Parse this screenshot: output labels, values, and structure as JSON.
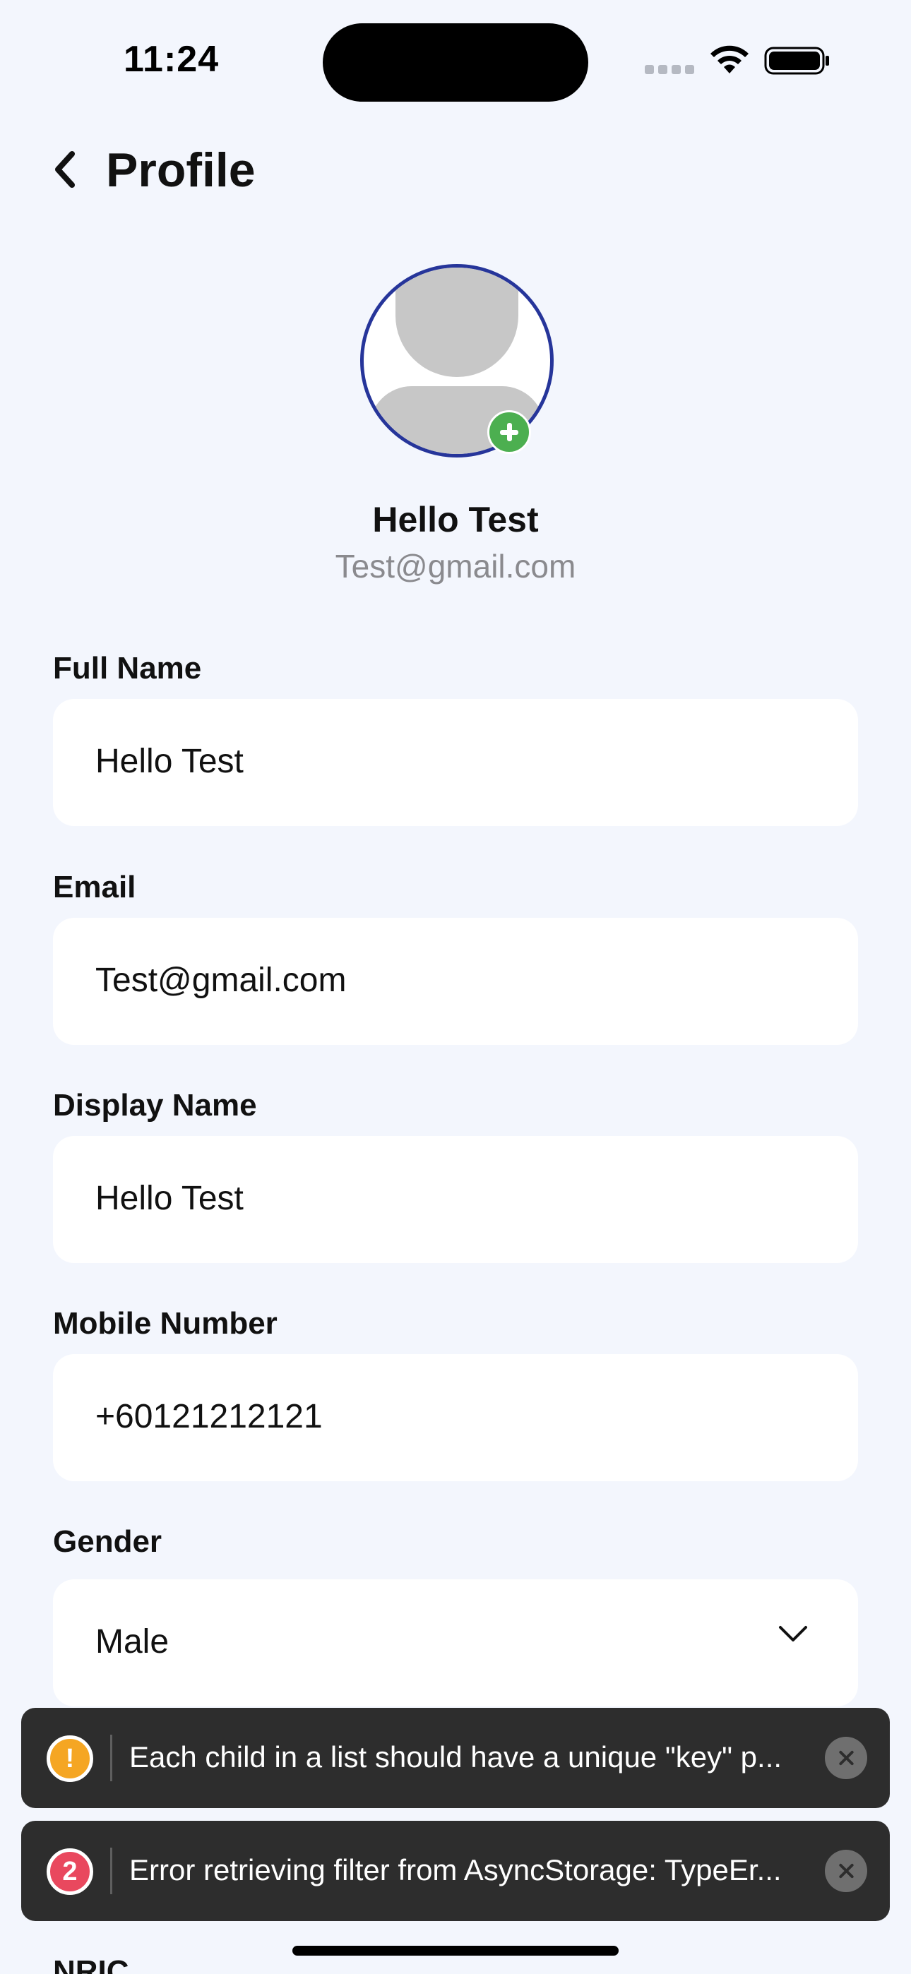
{
  "status_bar": {
    "time": "11:24",
    "icons": [
      "signal-dots-icon",
      "wifi-icon",
      "battery-icon"
    ]
  },
  "header": {
    "back_icon": "chevron-left-icon",
    "title": "Profile"
  },
  "profile": {
    "name": "Hello Test",
    "email": "Test@gmail.com"
  },
  "form": {
    "full_name": {
      "label": "Full Name",
      "value": "Hello Test"
    },
    "email": {
      "label": "Email",
      "value": "Test@gmail.com"
    },
    "display_name": {
      "label": "Display Name",
      "value": "Hello Test"
    },
    "mobile_number": {
      "label": "Mobile Number",
      "value": "+60121212121"
    },
    "gender": {
      "label": "Gender",
      "value": "Male"
    },
    "nric": {
      "label": "NRIC"
    }
  },
  "toasts": [
    {
      "type": "warning",
      "badge": "!",
      "message": "Each child in a list should have a unique \"key\" p...",
      "color": "#f5a623"
    },
    {
      "type": "error",
      "badge": "2",
      "message": "Error retrieving filter from AsyncStorage: TypeEr...",
      "color": "#e9485e"
    }
  ],
  "colors": {
    "background": "#f3f6fd",
    "avatar_border": "#26359a",
    "add_button": "#4caf50",
    "toast_background": "#2d2d2d"
  }
}
